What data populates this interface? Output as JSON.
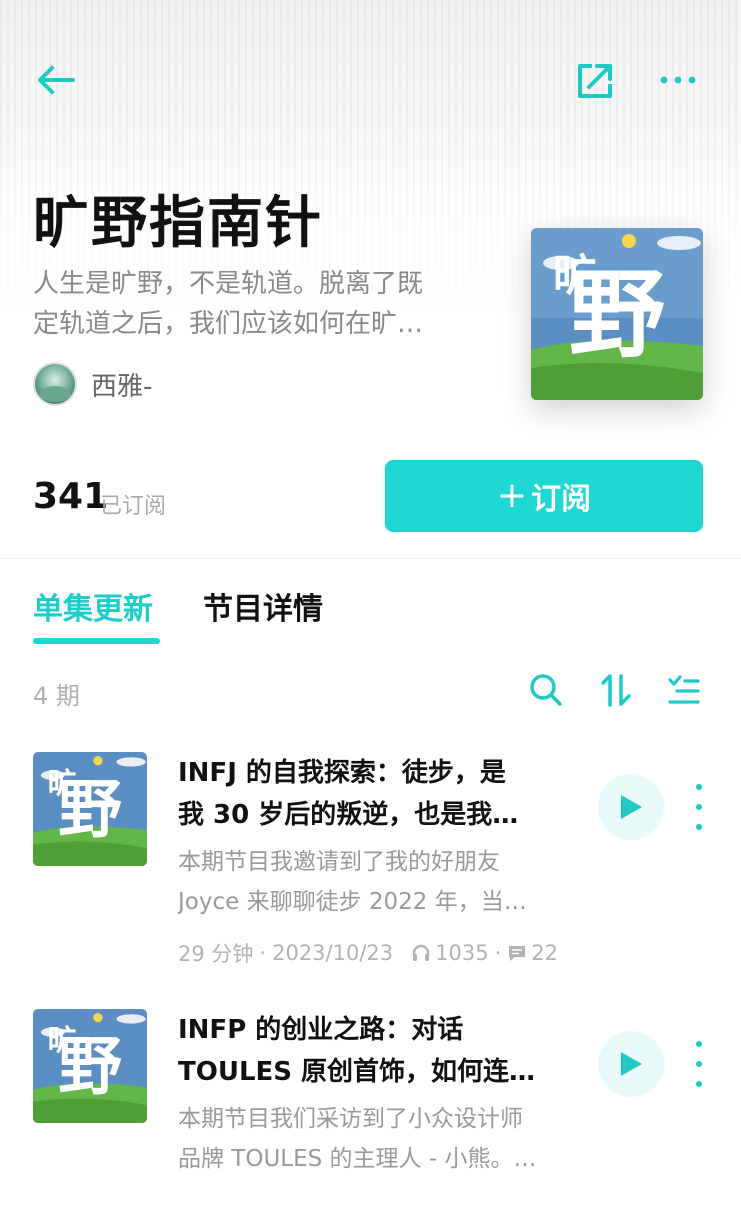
{
  "colors": {
    "accent": "#1fd8d4",
    "accent_text": "#1ccdca",
    "muted": "#9a9a9a"
  },
  "header": {
    "back_icon": "arrow-left-icon",
    "share_icon": "share-icon",
    "more_icon": "more-horizontal-icon"
  },
  "podcast": {
    "title": "旷野指南针",
    "description_line1": "人生是旷野，不是轨道。脱离了既",
    "description_line2": "定轨道之后，我们应该如何在旷…",
    "author": "西雅-",
    "subscriber_count": "341",
    "subscriber_label": "已订阅",
    "subscribe_button": "订阅",
    "subscribe_plus": "+"
  },
  "tabs": [
    {
      "label": "单集更新",
      "active": true
    },
    {
      "label": "节目详情",
      "active": false
    }
  ],
  "list_header": {
    "episode_count": "4 期",
    "tools": [
      "search-icon",
      "sort-icon",
      "select-list-icon"
    ]
  },
  "episodes": [
    {
      "title_line1": "INFJ 的自我探索：徒步，是",
      "title_line2": "我 30 岁后的叛逆，也是我…",
      "desc_line1": "本期节目我邀请到了我的好朋友",
      "desc_line2": "Joyce 来聊聊徒步 2022 年，当…",
      "duration": "29 分钟",
      "date": "2023/10/23",
      "plays": "1035",
      "comments": "22"
    },
    {
      "title_line1": "INFP 的创业之路：对话",
      "title_line2": "TOULES 原创首饰，如何连…",
      "desc_line1": "本期节目我们采访到了小众设计师",
      "desc_line2": "品牌 TOULES 的主理人 - 小熊。…"
    }
  ]
}
